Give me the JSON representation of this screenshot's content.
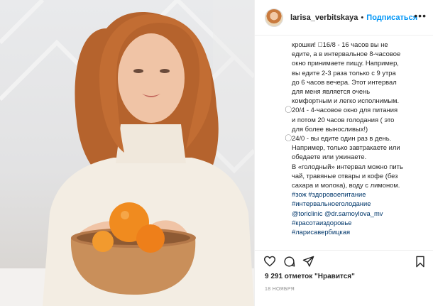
{
  "header": {
    "username": "larisa_verbitskaya",
    "separator": "•",
    "follow_label": "Подписаться",
    "more_label": "•••"
  },
  "caption": {
    "lines": [
      "крошки!  ⃝16/8   - 16 часов вы не",
      "едите, а в интервальное 8-часовое",
      "окно принимаете пищу. Например,",
      "вы едите 2-3 раза только с 9 утра",
      "до 6 часов вечера. Этот интервал",
      "для меня является очень",
      "комфортным и легко исполнимым.",
      "⃝20/4 - 4-часовое окно для питания",
      "и потом 20 часов голодания ( это",
      "для более выносливых!)",
      "⃝24/0 - вы едите один раз в день.",
      "Например, только завтракаете или",
      "обедаете или ужинаете.",
      "В «голодный» интервал можно пить",
      "чай, травяные отвары и кофе (без",
      "сахара и молока), воду с лимоном."
    ],
    "hashtag_lines": [
      "#зож #здоровоепитание",
      "#интервальноеголодание",
      "@toriclinic @dr.samoylova_mv",
      "#красотаиздоровье",
      "#ларисавербицкая"
    ]
  },
  "actions": {
    "icons": [
      "heart-icon",
      "comment-icon",
      "share-icon",
      "bookmark-icon"
    ]
  },
  "likes_text": "9 291 отметок \"Нравится\"",
  "date_text": "18 НОЯБРЯ"
}
